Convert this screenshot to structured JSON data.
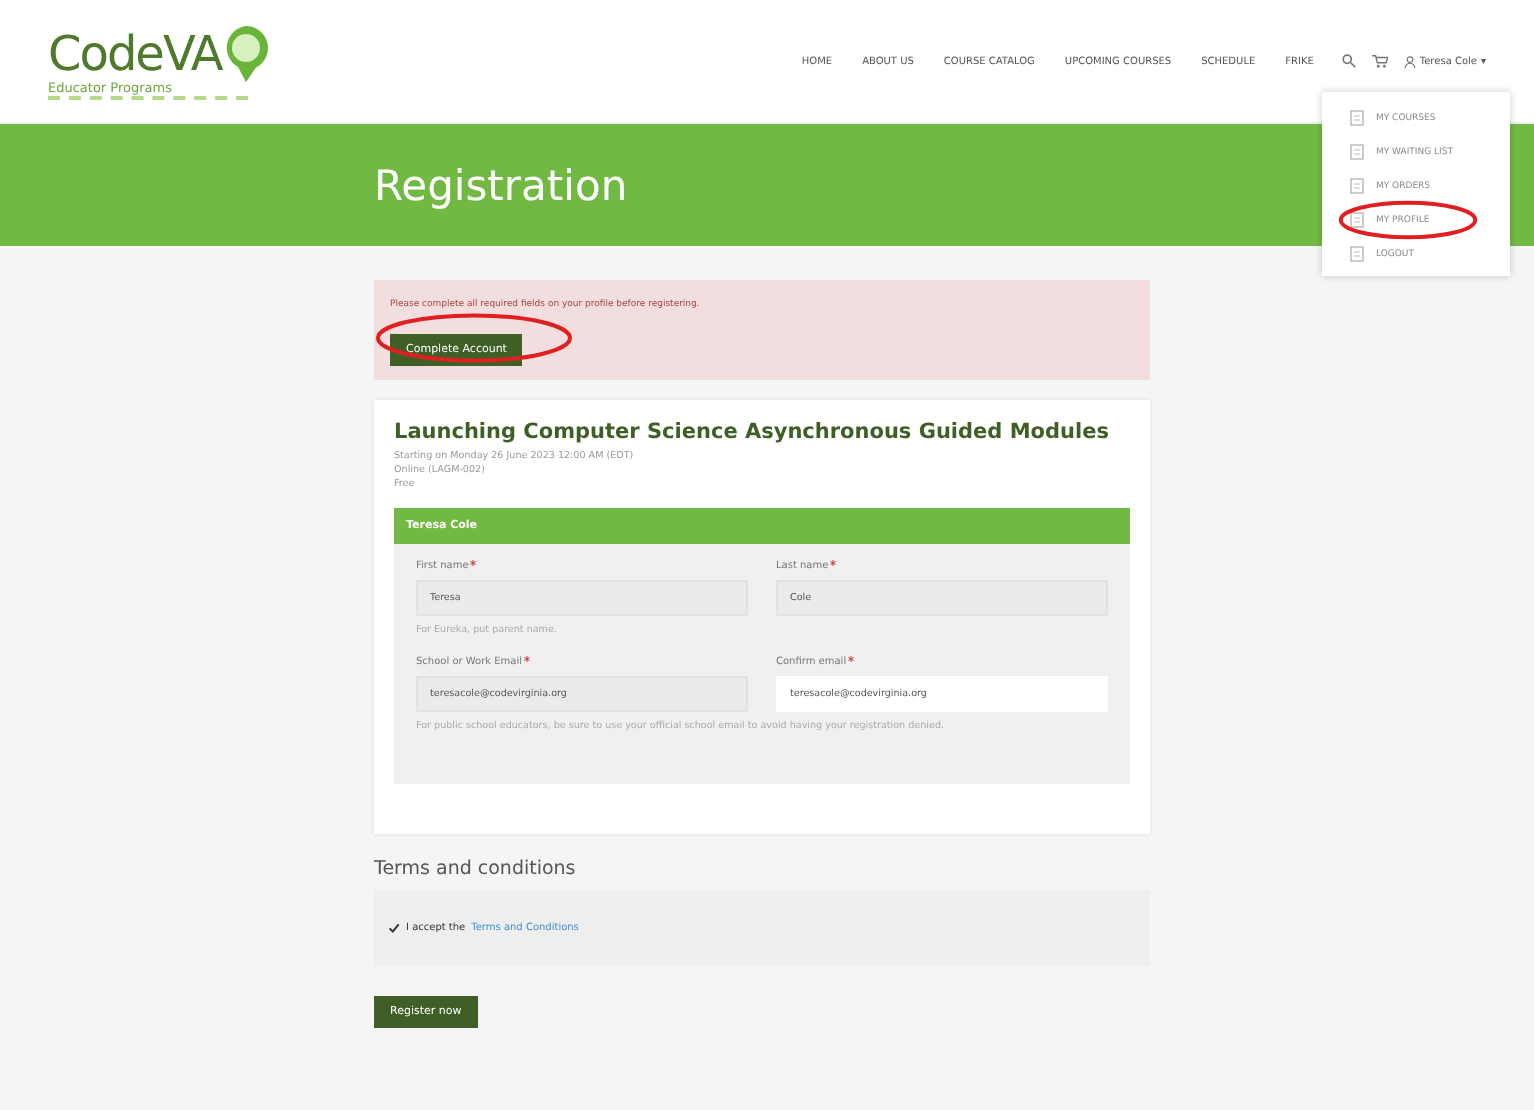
{
  "header": {
    "logo": {
      "name": "CodeVA",
      "tagline": "Educator Programs"
    },
    "nav": [
      "HOME",
      "ABOUT US",
      "COURSE CATALOG",
      "UPCOMING COURSES",
      "SCHEDULE",
      "FRIKE"
    ],
    "user": {
      "name": "Teresa Cole",
      "caret": "▾"
    }
  },
  "user_menu": {
    "items": [
      {
        "label": "MY COURSES",
        "annotated": false
      },
      {
        "label": "MY WAITING LIST",
        "annotated": false
      },
      {
        "label": "MY ORDERS",
        "annotated": false
      },
      {
        "label": "MY PROFILE",
        "annotated": true
      },
      {
        "label": "LOGOUT",
        "annotated": false
      }
    ]
  },
  "banner": {
    "title": "Registration"
  },
  "alert": {
    "message": "Please complete all required fields on your profile before registering.",
    "button": {
      "label": "Complete Account",
      "annotated": true
    }
  },
  "course": {
    "title": "Launching Computer Science Asynchronous Guided Modules",
    "details": [
      "Starting on Monday 26 June 2023 12:00 AM (EDT)",
      "Online (LAGM-002)",
      "Free"
    ]
  },
  "attendee": {
    "name": "Teresa Cole",
    "rows": [
      {
        "fields": [
          {
            "label": "First name",
            "required": true,
            "value": "Teresa",
            "disabled": true
          },
          {
            "label": "Last name",
            "required": true,
            "value": "Cole",
            "disabled": true
          }
        ],
        "hint": "For Eureka, put parent name."
      },
      {
        "fields": [
          {
            "label": "School or Work Email",
            "required": true,
            "value": "teresacole@codevirginia.org",
            "disabled": true
          },
          {
            "label": "Confirm email",
            "required": true,
            "value": "teresacole@codevirginia.org",
            "disabled": false
          }
        ],
        "hint": "For public school educators, be sure to use your official school email to avoid having your registration denied."
      }
    ]
  },
  "terms": {
    "heading": "Terms and conditions",
    "checked": true,
    "text": "I accept the",
    "link": "Terms and Conditions"
  },
  "register_button": "Register now"
}
